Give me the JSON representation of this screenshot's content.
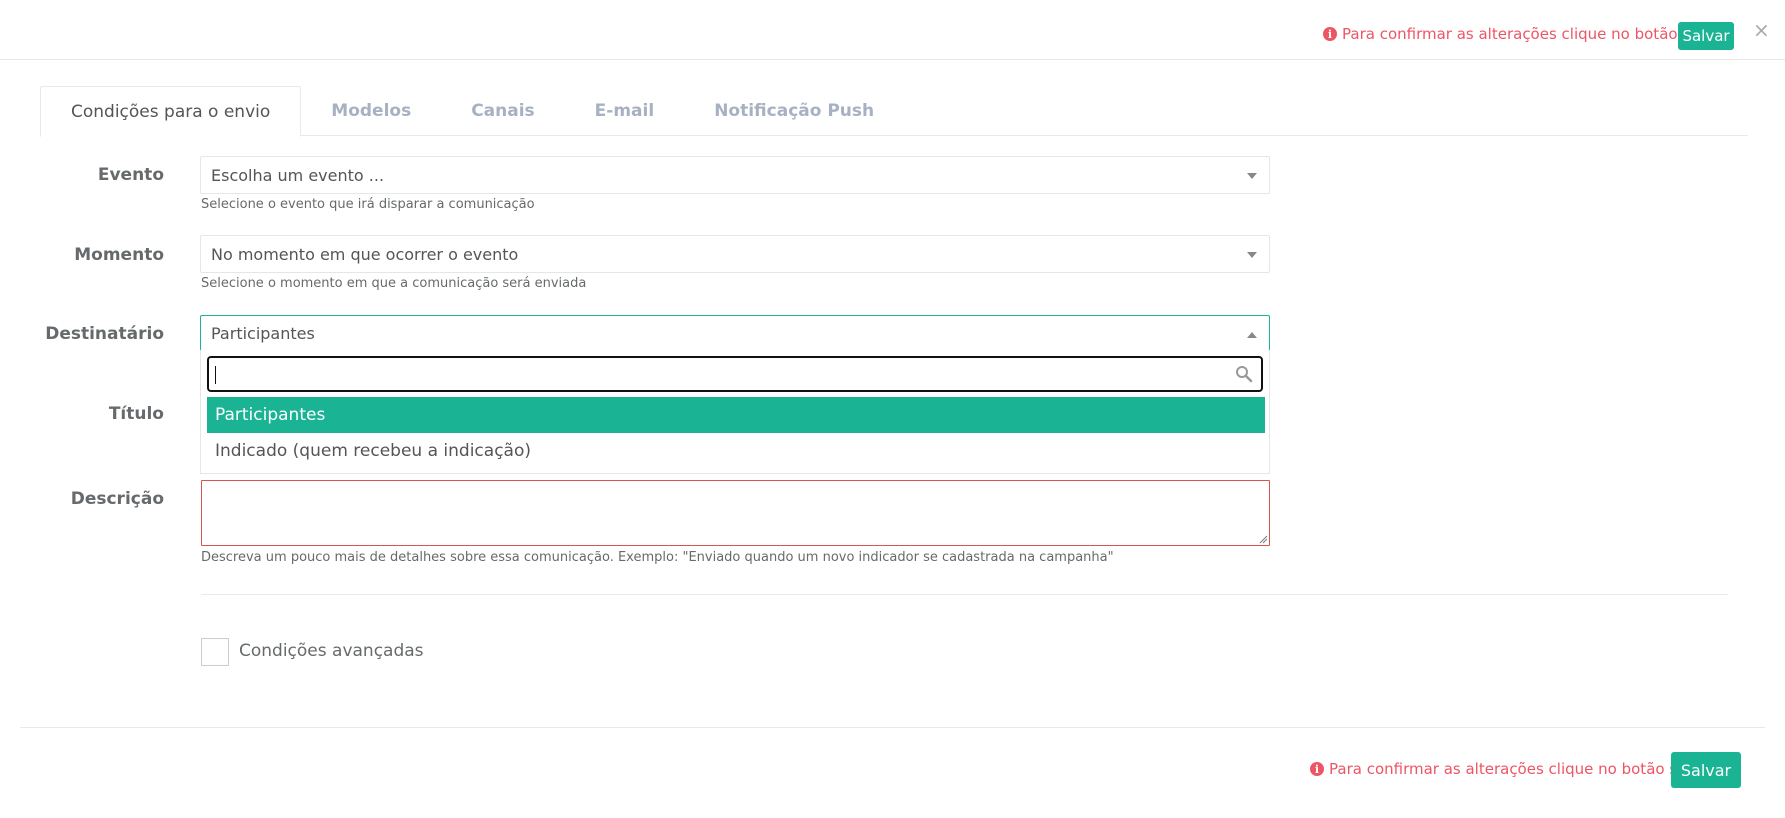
{
  "header": {
    "warning_text": "Para confirmar as alterações clique no botão salvar.",
    "save_label": "Salvar",
    "close_symbol": "×"
  },
  "tabs": [
    {
      "label": "Condições para o envio",
      "active": true
    },
    {
      "label": "Modelos",
      "active": false
    },
    {
      "label": "Canais",
      "active": false
    },
    {
      "label": "E-mail",
      "active": false
    },
    {
      "label": "Notificação Push",
      "active": false
    }
  ],
  "form": {
    "evento": {
      "label": "Evento",
      "value": "Escolha um evento ...",
      "help": "Selecione o evento que irá disparar a comunicação"
    },
    "momento": {
      "label": "Momento",
      "value": "No momento em que ocorrer o evento",
      "help": "Selecione o momento em que a comunicação será enviada"
    },
    "destinatario": {
      "label": "Destinatário",
      "value": "Participantes",
      "search_value": "",
      "options": [
        {
          "label": "Participantes",
          "selected": true
        },
        {
          "label": "Indicado (quem recebeu a indicação)",
          "selected": false
        }
      ]
    },
    "titulo": {
      "label": "Título"
    },
    "descricao": {
      "label": "Descrição",
      "value": "",
      "help": "Descreva um pouco mais de detalhes sobre essa comunicação. Exemplo: \"Enviado quando um novo indicador se cadastrada na campanha\""
    },
    "advanced": {
      "label": "Condições avançadas",
      "checked": false
    }
  },
  "footer": {
    "warning_text": "Para confirmar as alterações clique no botão salvar.",
    "save_label": "Salvar"
  },
  "colors": {
    "accent": "#1ab394",
    "warning": "#ed5565",
    "error_border": "#d9534f"
  },
  "icons": {
    "info": "info-circle-icon",
    "search": "search-icon",
    "close": "close-icon",
    "caret": "chevron-down-icon"
  }
}
